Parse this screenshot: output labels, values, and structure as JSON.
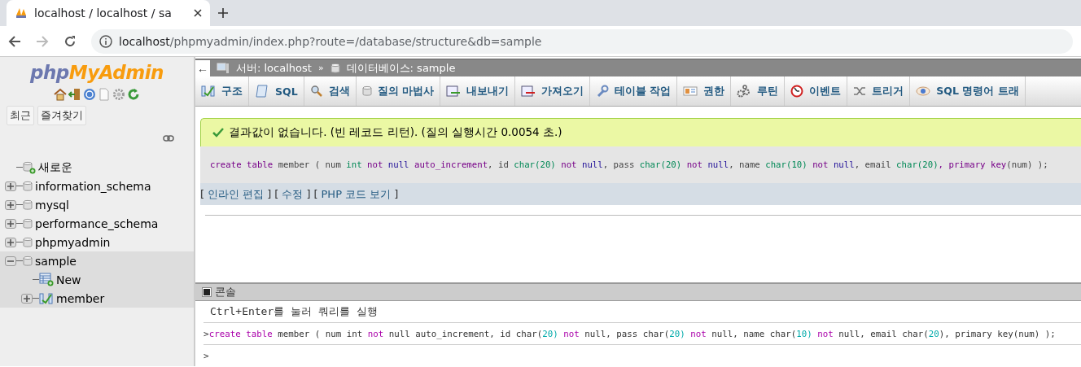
{
  "browser": {
    "tab_title": "localhost / localhost / sa",
    "url_host": "localhost",
    "url_path": "/phpmyadmin/index.php?route=/database/structure&db=sample"
  },
  "sidebar": {
    "logo_parts": [
      "php",
      "MyAdmin"
    ],
    "buttons": [
      "최근",
      "즐겨찾기"
    ],
    "tree": [
      {
        "label": "새로운",
        "kind": "new",
        "selected": false
      },
      {
        "label": "information_schema",
        "kind": "db",
        "expanded": false,
        "selected": false
      },
      {
        "label": "mysql",
        "kind": "db",
        "expanded": false,
        "selected": false
      },
      {
        "label": "performance_schema",
        "kind": "db",
        "expanded": false,
        "selected": false
      },
      {
        "label": "phpmyadmin",
        "kind": "db",
        "expanded": false,
        "selected": false
      },
      {
        "label": "sample",
        "kind": "db",
        "expanded": true,
        "selected": true,
        "children": [
          {
            "label": "New",
            "kind": "new"
          },
          {
            "label": "member",
            "kind": "table",
            "expanded": false
          }
        ]
      }
    ]
  },
  "breadcrumb": {
    "back": "←",
    "server": "서버: localhost",
    "separator": "»",
    "database": "데이터베이스: sample"
  },
  "menu": [
    "구조",
    "SQL",
    "검색",
    "질의 마법사",
    "내보내기",
    "가져오기",
    "테이블 작업",
    "권한",
    "루틴",
    "이벤트",
    "트리거",
    "SQL 명령어 트래"
  ],
  "message": "결과값이 없습니다. (빈 레코드 리턴). (질의 실행시간 0.0054 초.)",
  "query": [
    {
      "t": "create table",
      "kind": "keyword"
    },
    {
      "t": " member ( num",
      "kind": "plain"
    },
    {
      "t": " int",
      "kind": "type"
    },
    {
      "t": " not",
      "kind": "keyword"
    },
    {
      "t": " null",
      "kind": "atom"
    },
    {
      "t": " auto_increment",
      "kind": "keyword"
    },
    {
      "t": ", id",
      "kind": "plain"
    },
    {
      "t": " char(20)",
      "kind": "type"
    },
    {
      "t": " not",
      "kind": "keyword"
    },
    {
      "t": " null",
      "kind": "atom"
    },
    {
      "t": ", pass",
      "kind": "plain"
    },
    {
      "t": " char(20)",
      "kind": "type"
    },
    {
      "t": " not",
      "kind": "keyword"
    },
    {
      "t": " null",
      "kind": "atom"
    },
    {
      "t": ", name",
      "kind": "plain"
    },
    {
      "t": " char(10)",
      "kind": "type"
    },
    {
      "t": " not",
      "kind": "keyword"
    },
    {
      "t": " null",
      "kind": "atom"
    },
    {
      "t": ", email",
      "kind": "plain"
    },
    {
      "t": " char(20)",
      "kind": "type"
    },
    {
      "t": ", primary key",
      "kind": "keyword"
    },
    {
      "t": "(num) );",
      "kind": "plain"
    }
  ],
  "query_links": [
    {
      "open": "[",
      "label": "인라인 편집",
      "close": "]"
    },
    {
      "open": "[",
      "label": "수정",
      "close": "]"
    },
    {
      "open": "[",
      "label": "PHP 코드 보기",
      "close": "]"
    }
  ],
  "console": {
    "title": "콘솔",
    "hint": "Ctrl+Enter를 눌러 쿼리를 실행",
    "prompt": ">",
    "history": [
      {
        "t": "create table",
        "kind": "keyword"
      },
      {
        "t": " member ( num int",
        "kind": "plain"
      },
      {
        "t": " not",
        "kind": "keyword"
      },
      {
        "t": " null auto_increment, id char(",
        "kind": "plain"
      },
      {
        "t": "20)",
        "kind": "number"
      },
      {
        "t": " not",
        "kind": "keyword"
      },
      {
        "t": " null, pass char(",
        "kind": "plain"
      },
      {
        "t": "20)",
        "kind": "number"
      },
      {
        "t": " not",
        "kind": "keyword"
      },
      {
        "t": " null, name char(",
        "kind": "plain"
      },
      {
        "t": "10)",
        "kind": "number"
      },
      {
        "t": " not",
        "kind": "keyword"
      },
      {
        "t": " null, email char(",
        "kind": "plain"
      },
      {
        "t": "20",
        "kind": "number"
      },
      {
        "t": "), primary key(num) );",
        "kind": "plain"
      }
    ],
    "input_prompt": ">"
  }
}
